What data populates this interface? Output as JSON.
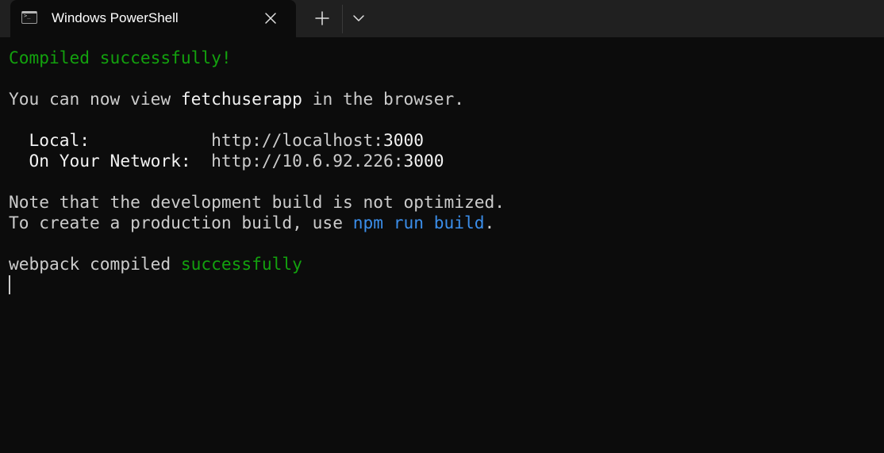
{
  "window": {
    "tab_title": "Windows PowerShell",
    "tab_icon": "terminal-icon",
    "close_icon": "close-icon",
    "new_tab_icon": "plus-icon",
    "dropdown_icon": "chevron-down-icon"
  },
  "colors": {
    "background": "#0c0c0c",
    "titlebar": "#202020",
    "text": "#cccccc",
    "bright_text": "#f2f2f2",
    "green": "#13a10e",
    "blue": "#3b8eea"
  },
  "terminal": {
    "compiled_message": "Compiled successfully!",
    "view_prefix": "You can now view ",
    "app_name": "fetchuserapp",
    "view_suffix": " in the browser.",
    "local_label": "  Local:            ",
    "local_url_base": "http://localhost:",
    "local_port": "3000",
    "network_label": "  On Your Network:  ",
    "network_url_base": "http://10.6.92.226:",
    "network_port": "3000",
    "note_line": "Note that the development build is not optimized.",
    "prod_prefix": "To create a production build, use ",
    "npm_command": "npm run build",
    "prod_suffix": ".",
    "webpack_prefix": "webpack compiled ",
    "webpack_status": "successfully"
  }
}
